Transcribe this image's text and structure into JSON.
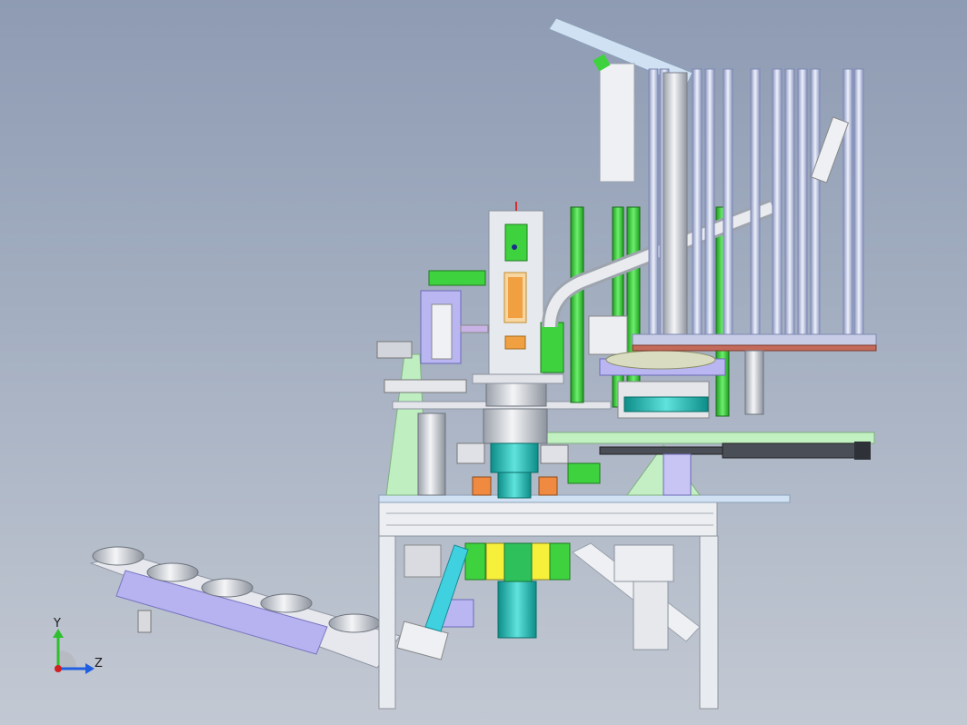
{
  "viewport": {
    "background_top": "#8e9bb3",
    "background_bottom": "#c3c9d3"
  },
  "colors": {
    "frame": "#e8ebef",
    "frame_edge": "#9aa2ad",
    "green": "#3fd23f",
    "light_green": "#bfeec0",
    "lavender": "#b9b6f2",
    "steel": "#c9ccd3",
    "teal": "#19b7b0",
    "orange": "#f0a040",
    "dark": "#3a3d44",
    "rod": "#b9c4e6"
  },
  "triad": {
    "y_label": "Y",
    "z_label": "Z",
    "y_color": "#2fbf2f",
    "z_color": "#2060e0",
    "x_color": "#d02020"
  },
  "components": {
    "column_rods": "vertical-feed-rods",
    "main_frame": "machine-base-frame",
    "feed_chute": "inclined-part-chute"
  }
}
